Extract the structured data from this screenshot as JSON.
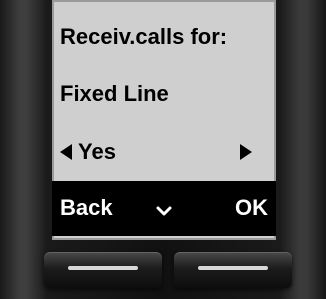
{
  "screen": {
    "title": "Receiv.calls for:",
    "value": "Fixed Line",
    "option": {
      "selected": "Yes",
      "left_icon": "triangle-left-icon",
      "right_icon": "triangle-right-icon"
    }
  },
  "softkeys": {
    "left_label": "Back",
    "center_icon": "chevron-down-icon",
    "right_label": "OK"
  },
  "colors": {
    "screen_bg": "#cfcfcf",
    "softkey_bar_bg": "#000000",
    "text": "#000000",
    "softkey_text": "#ffffff"
  }
}
